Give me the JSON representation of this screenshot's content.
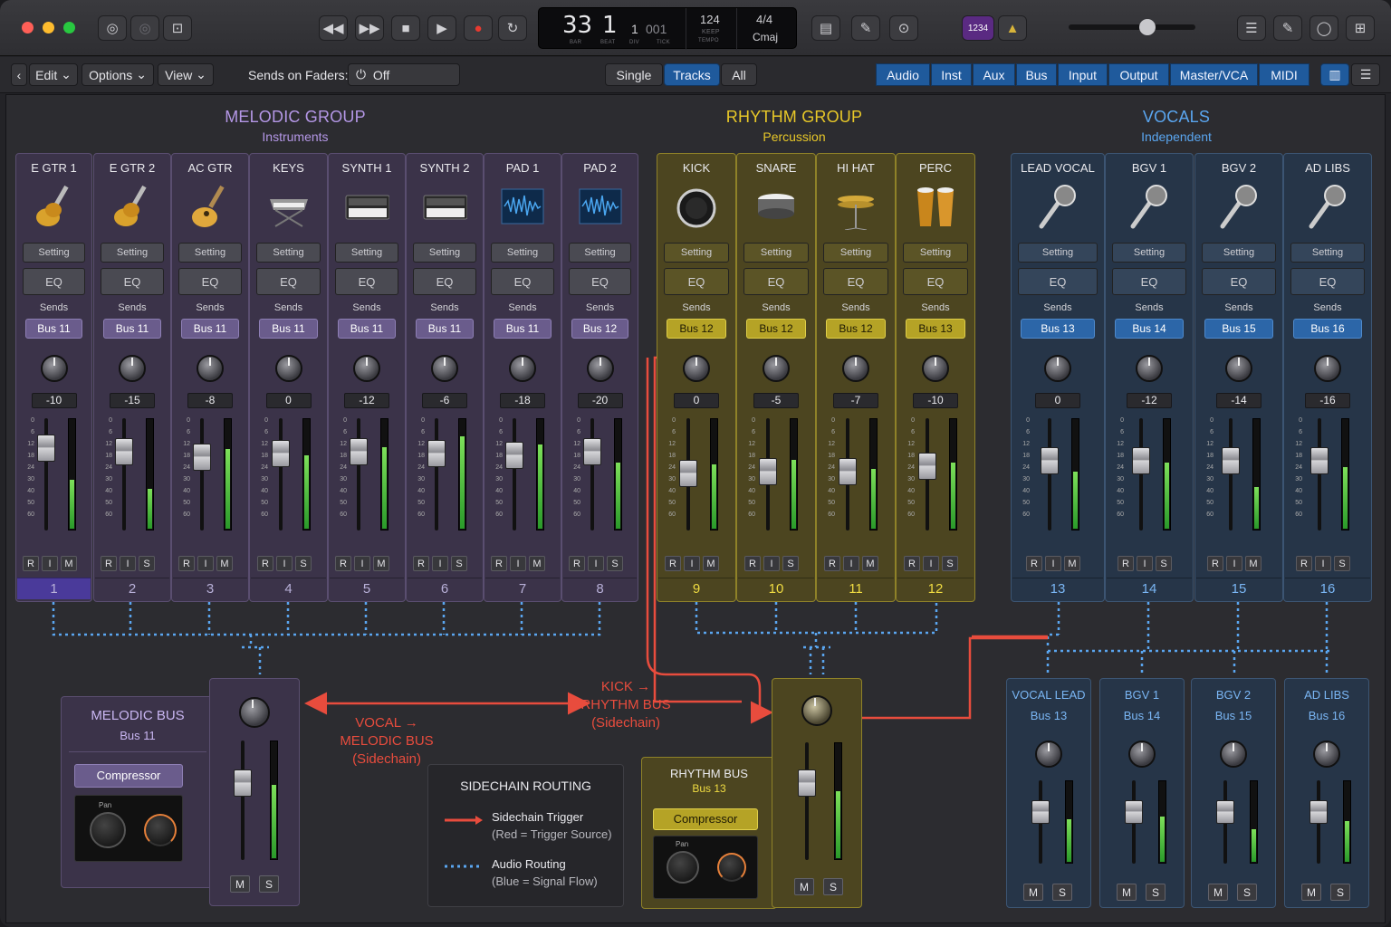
{
  "toolbar": {
    "edit": "Edit",
    "options": "Options",
    "view": "View",
    "sends_on_faders_label": "Sends on Faders:",
    "sends_on_faders_value": "Off",
    "single": "Single",
    "tracks": "Tracks",
    "all": "All",
    "filters": [
      "Audio",
      "Inst",
      "Aux",
      "Bus",
      "Input",
      "Output",
      "Master/VCA",
      "MIDI"
    ]
  },
  "lcd": {
    "bar": "33",
    "beat": "1",
    "div": "1",
    "tick": "001",
    "bar_lbl": "BAR",
    "beat_lbl": "BEAT",
    "div_lbl": "DIV",
    "tick_lbl": "TICK",
    "tempo": "124",
    "keep": "KEEP",
    "tempo_lbl": "TEMPO",
    "sig": "4/4",
    "key": "Cmaj"
  },
  "badge": "1234",
  "groups": {
    "melodic": {
      "title": "MELODIC GROUP",
      "sub": "Instruments"
    },
    "rhythm": {
      "title": "RHYTHM GROUP",
      "sub": "Percussion"
    },
    "vocals": {
      "title": "VOCALS",
      "sub": "Independent"
    }
  },
  "strip_labels": {
    "setting": "Setting",
    "eq": "EQ",
    "sends": "Sends"
  },
  "channels": [
    {
      "name": "E GTR 1",
      "bus": "Bus 11",
      "vol": "-10",
      "num": "1",
      "icon": "electric-guitar-icon"
    },
    {
      "name": "E GTR 2",
      "bus": "Bus 11",
      "vol": "-15",
      "num": "2",
      "icon": "electric-guitar-icon"
    },
    {
      "name": "AC GTR",
      "bus": "Bus 11",
      "vol": "-8",
      "num": "3",
      "icon": "acoustic-guitar-icon"
    },
    {
      "name": "KEYS",
      "bus": "Bus 11",
      "vol": "0",
      "num": "4",
      "icon": "keyboard-icon"
    },
    {
      "name": "SYNTH 1",
      "bus": "Bus 11",
      "vol": "-12",
      "num": "5",
      "icon": "synth-icon"
    },
    {
      "name": "SYNTH 2",
      "bus": "Bus 11",
      "vol": "-6",
      "num": "6",
      "icon": "synth-icon"
    },
    {
      "name": "PAD 1",
      "bus": "Bus 11",
      "vol": "-18",
      "num": "7",
      "icon": "waveform-icon"
    },
    {
      "name": "PAD 2",
      "bus": "Bus 12",
      "vol": "-20",
      "num": "8",
      "icon": "waveform-icon"
    },
    {
      "name": "KICK",
      "bus": "Bus 12",
      "vol": "0",
      "num": "9",
      "icon": "kick-drum-icon"
    },
    {
      "name": "SNARE",
      "bus": "Bus 12",
      "vol": "-5",
      "num": "10",
      "icon": "snare-drum-icon"
    },
    {
      "name": "HI HAT",
      "bus": "Bus 12",
      "vol": "-7",
      "num": "11",
      "icon": "hi-hat-icon"
    },
    {
      "name": "PERC",
      "bus": "Bus 13",
      "vol": "-10",
      "num": "12",
      "icon": "conga-icon"
    },
    {
      "name": "LEAD VOCAL",
      "bus": "Bus 13",
      "vol": "0",
      "num": "13",
      "icon": "microphone-icon"
    },
    {
      "name": "BGV 1",
      "bus": "Bus 14",
      "vol": "-12",
      "num": "14",
      "icon": "microphone-icon"
    },
    {
      "name": "BGV 2",
      "bus": "Bus 15",
      "vol": "-14",
      "num": "15",
      "icon": "microphone-icon"
    },
    {
      "name": "AD LIBS",
      "bus": "Bus 16",
      "vol": "-16",
      "num": "16",
      "icon": "microphone-icon"
    }
  ],
  "scale": [
    "0",
    "6",
    "12",
    "18",
    "24",
    "30",
    "40",
    "50",
    "60"
  ],
  "buttons": {
    "r": "R",
    "i": "I",
    "m": "M",
    "s": "S",
    "ms_m": "M",
    "ms_s": "S"
  },
  "melodic_bus": {
    "title": "MELODIC BUS",
    "sub": "Bus 11",
    "plugin": "Compressor",
    "pan": "Pan"
  },
  "rhythm_bus": {
    "title": "RHYTHM BUS",
    "sub": "Bus 13",
    "plugin": "Compressor",
    "pan": "Pan"
  },
  "vocal_buses": [
    {
      "name": "VOCAL LEAD",
      "bus": "Bus 13"
    },
    {
      "name": "BGV 1",
      "bus": "Bus 14"
    },
    {
      "name": "BGV 2",
      "bus": "Bus 15"
    },
    {
      "name": "AD LIBS",
      "bus": "Bus 16"
    }
  ],
  "annotations": {
    "vocal": [
      "VOCAL →",
      "MELODIC BUS",
      "(Sidechain)"
    ],
    "kick": [
      "KICK →",
      "RHYTHM BUS",
      "(Sidechain)"
    ]
  },
  "legend": {
    "title": "SIDECHAIN ROUTING",
    "red1": "Sidechain Trigger",
    "red2": "(Red = Trigger Source)",
    "blue1": "Audio Routing",
    "blue2": "(Blue = Signal Flow)"
  },
  "colors": {
    "purple": "#b497e6",
    "yellow": "#e8c828",
    "blue": "#5aa6f0",
    "red": "#e84c3d"
  }
}
